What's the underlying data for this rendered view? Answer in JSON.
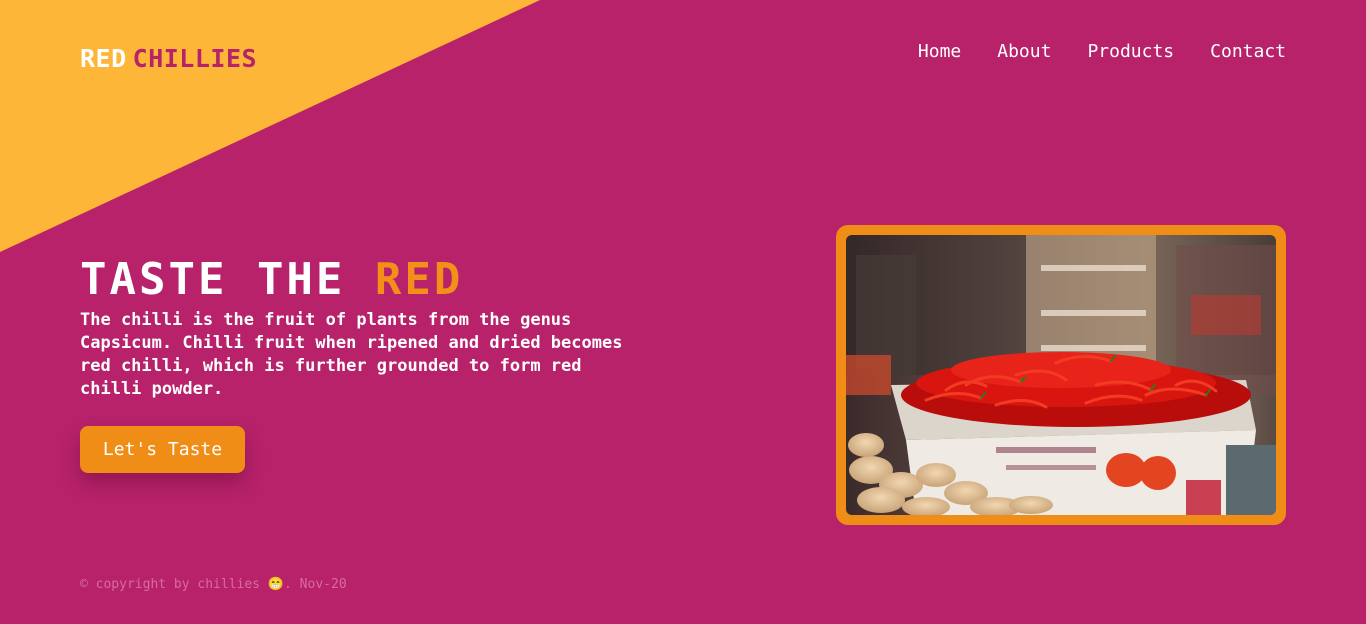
{
  "brand": {
    "part1": "RED",
    "part2": "CHILLIES"
  },
  "nav": {
    "items": [
      "Home",
      "About",
      "Products",
      "Contact"
    ]
  },
  "hero": {
    "title_main": "TASTE THE",
    "title_accent": "RED",
    "description": "The chilli is the fruit of plants from the genus Capsicum. Chilli fruit when ripened and dried becomes red chilli, which is further grounded to form red chilli powder.",
    "cta_label": "Let's Taste"
  },
  "image": {
    "subject": "crate of red chillies at a market stall with ginger in front"
  },
  "footer": {
    "copyright": "© copyright by chillies 😁. Nov-20"
  },
  "colors": {
    "background": "#b7226b",
    "accent_yellow": "#fdb637",
    "accent_orange": "#ef8d17",
    "text": "#ffffff"
  }
}
